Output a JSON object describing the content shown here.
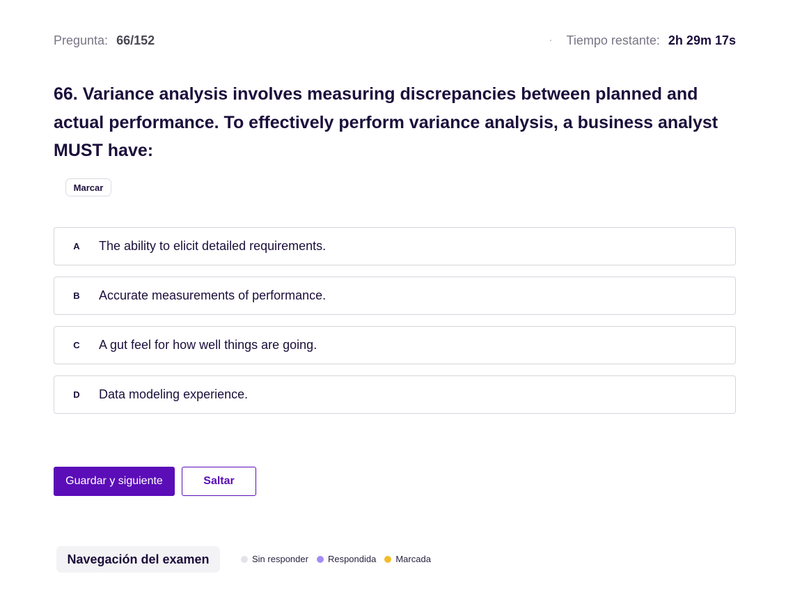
{
  "header": {
    "question_label": "Pregunta:",
    "question_progress": "66/152",
    "timer_label": "Tiempo restante:",
    "timer_value": "2h 29m 17s"
  },
  "question": {
    "text": "66. Variance analysis involves measuring discrepancies between planned and actual performance. To effectively perform variance analysis, a business analyst MUST have:",
    "flag_label": "Marcar"
  },
  "options": [
    {
      "letter": "A",
      "text": "The ability to elicit detailed requirements."
    },
    {
      "letter": "B",
      "text": "Accurate measurements of performance."
    },
    {
      "letter": "C",
      "text": "A gut feel for how well things are going."
    },
    {
      "letter": "D",
      "text": "Data modeling experience."
    }
  ],
  "actions": {
    "save_next_label": "Guardar y siguiente",
    "skip_label": "Saltar"
  },
  "navigation": {
    "title": "Navegación del examen",
    "legend": [
      {
        "label": "Sin responder",
        "color": "#e4e3e8"
      },
      {
        "label": "Respondida",
        "color": "#a58cf5"
      },
      {
        "label": "Marcada",
        "color": "#f2bd2c"
      }
    ]
  },
  "colors": {
    "primary": "#5b0db8",
    "text": "#1b0f3b"
  }
}
